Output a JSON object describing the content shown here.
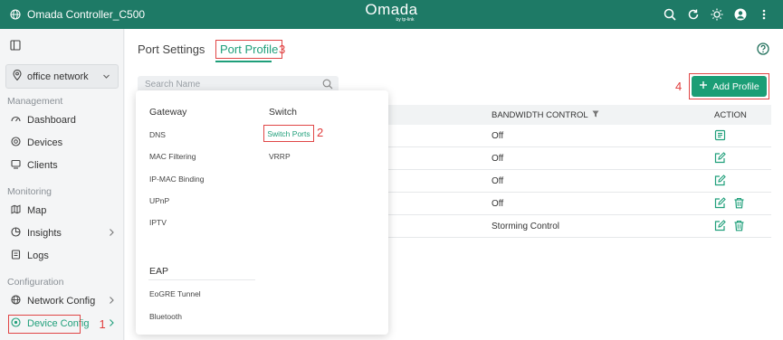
{
  "topbar": {
    "site_name": "Omada Controller_C500",
    "brand": "Omada",
    "brand_sub": "by tp-link",
    "icons": [
      "search-icon",
      "refresh-icon",
      "sun-icon",
      "user-avatar-icon",
      "more-icon"
    ]
  },
  "sidebar": {
    "site_selector": "office network",
    "sections": {
      "management": "Management",
      "monitoring": "Monitoring",
      "configuration": "Configuration"
    },
    "items": [
      {
        "label": "Dashboard",
        "icon": "dashboard-icon"
      },
      {
        "label": "Devices",
        "icon": "devices-icon"
      },
      {
        "label": "Clients",
        "icon": "clients-icon"
      },
      {
        "label": "Map",
        "icon": "map-icon"
      },
      {
        "label": "Insights",
        "icon": "insights-icon"
      },
      {
        "label": "Logs",
        "icon": "logs-icon"
      },
      {
        "label": "Network Config",
        "icon": "globe-icon"
      },
      {
        "label": "Device Config",
        "icon": "device-config-icon"
      }
    ]
  },
  "tabs": {
    "port_settings": "Port Settings",
    "port_profile": "Port Profile"
  },
  "steps": {
    "one": "1",
    "two": "2",
    "three": "3",
    "four": "4"
  },
  "search": {
    "placeholder": "Search Name"
  },
  "add_profile": {
    "label": "Add Profile"
  },
  "table": {
    "headers": {
      "bandwidth": "BANDWIDTH CONTROL",
      "action": "ACTION"
    },
    "rows": [
      {
        "bandwidth": "Off"
      },
      {
        "bandwidth": "Off"
      },
      {
        "bandwidth": "Off"
      },
      {
        "bandwidth": "Off"
      },
      {
        "bandwidth": "Storming Control"
      }
    ]
  },
  "dropdown": {
    "gateway": {
      "title": "Gateway",
      "items": [
        "DNS",
        "MAC Filtering",
        "IP-MAC Binding",
        "UPnP",
        "IPTV"
      ]
    },
    "switch": {
      "title": "Switch",
      "items": [
        "Switch Ports",
        "VRRP"
      ]
    },
    "eap": {
      "title": "EAP",
      "items": [
        "EoGRE Tunnel",
        "Bluetooth"
      ]
    }
  },
  "colors": {
    "accent": "#1f9f7a",
    "topbar": "#1e7a66",
    "highlight": "#e04646"
  }
}
